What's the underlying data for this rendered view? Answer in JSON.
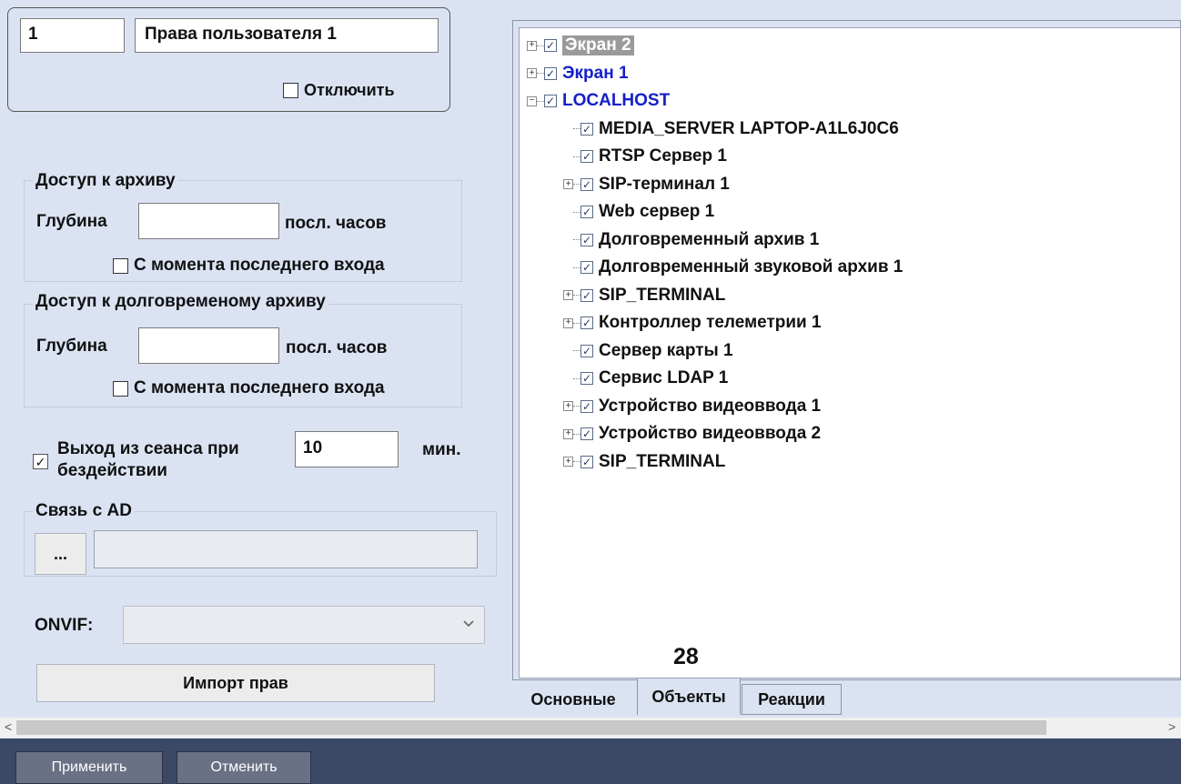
{
  "header": {
    "id_value": "1",
    "name_value": "Права пользователя 1",
    "disable_label": "Отключить"
  },
  "archive_access": {
    "title": "Доступ к архиву",
    "depth_label": "Глубина",
    "depth_value": "",
    "hours_label": "посл. часов",
    "since_login_label": "С момента последнего входа"
  },
  "long_archive_access": {
    "title": "Доступ к долговременому архиву",
    "depth_label": "Глубина",
    "depth_value": "",
    "hours_label": "посл. часов",
    "since_login_label": "С момента последнего входа"
  },
  "session": {
    "label_line1": "Выход из сеанса при",
    "label_line2": "бездействии",
    "value": "10",
    "unit": "мин.",
    "checked": true
  },
  "ad": {
    "title": "Связь с AD",
    "browse_label": "...",
    "value": ""
  },
  "onvif": {
    "label": "ONVIF:",
    "value": ""
  },
  "import_label": "Импорт прав",
  "tree": {
    "items": [
      {
        "label": "Экран 2",
        "level": 0,
        "expander": "+",
        "style": "selected"
      },
      {
        "label": "Экран 1",
        "level": 0,
        "expander": "+",
        "style": "link"
      },
      {
        "label": "LOCALHOST",
        "level": 0,
        "expander": "−",
        "style": "link"
      },
      {
        "label": "MEDIA_SERVER LAPTOP-A1L6J0C6",
        "level": 1,
        "expander": "",
        "style": "normal"
      },
      {
        "label": "RTSP Сервер 1",
        "level": 1,
        "expander": "",
        "style": "normal"
      },
      {
        "label": "SIP-терминал 1",
        "level": 1,
        "expander": "+",
        "style": "normal"
      },
      {
        "label": "Web сервер 1",
        "level": 1,
        "expander": "",
        "style": "normal"
      },
      {
        "label": "Долговременный архив 1",
        "level": 1,
        "expander": "",
        "style": "normal"
      },
      {
        "label": "Долговременный звуковой архив 1",
        "level": 1,
        "expander": "",
        "style": "normal"
      },
      {
        "label": "SIP_TERMINAL",
        "level": 1,
        "expander": "+",
        "style": "normal"
      },
      {
        "label": "Контроллер телеметрии 1",
        "level": 1,
        "expander": "+",
        "style": "normal"
      },
      {
        "label": "Сервер карты 1",
        "level": 1,
        "expander": "",
        "style": "normal"
      },
      {
        "label": "Сервис LDAP 1",
        "level": 1,
        "expander": "",
        "style": "normal"
      },
      {
        "label": "Устройство видеоввода 1",
        "level": 1,
        "expander": "+",
        "style": "normal"
      },
      {
        "label": "Устройство видеоввода 2",
        "level": 1,
        "expander": "+",
        "style": "normal"
      },
      {
        "label": "SIP_TERMINAL",
        "level": 1,
        "expander": "+",
        "style": "normal"
      }
    ]
  },
  "callout_number": "28",
  "tabs": [
    {
      "label": "Основные",
      "active": false
    },
    {
      "label": "Объекты",
      "active": true
    },
    {
      "label": "Реакции",
      "active": false
    }
  ],
  "footer": {
    "apply_label": "Применить",
    "cancel_label": "Отменить"
  },
  "colors": {
    "background": "#dbe3f3",
    "link": "#1520c8",
    "selected_bg": "#9a9a9a",
    "footer_bg": "#3b4866"
  }
}
